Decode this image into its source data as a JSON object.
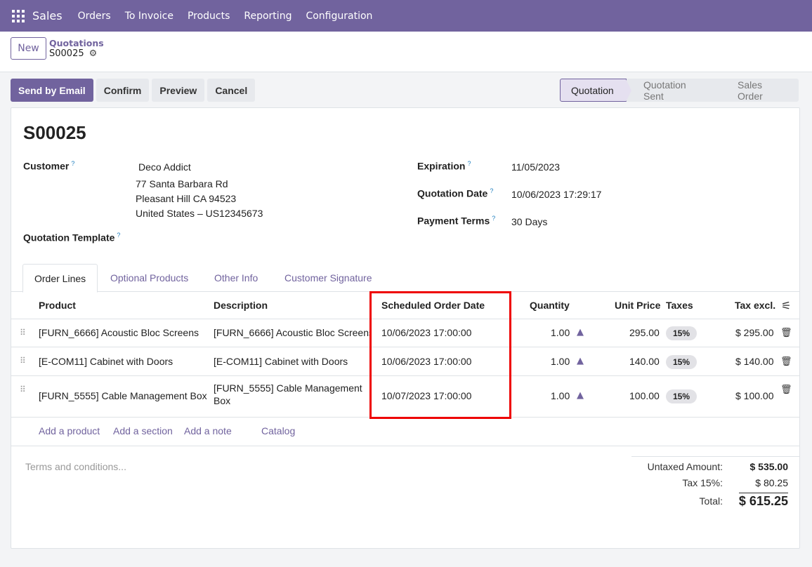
{
  "navbar": {
    "brand": "Sales",
    "items": [
      "Orders",
      "To Invoice",
      "Products",
      "Reporting",
      "Configuration"
    ],
    "color": "#71639e"
  },
  "control": {
    "new_label": "New",
    "breadcrumb_parent": "Quotations",
    "breadcrumb_current": "S00025"
  },
  "actions": {
    "send_by_email": "Send by Email",
    "confirm": "Confirm",
    "preview": "Preview",
    "cancel": "Cancel"
  },
  "statusbar": {
    "stages": [
      "Quotation",
      "Quotation Sent",
      "Sales Order"
    ],
    "active": "Quotation"
  },
  "record": {
    "title": "S00025",
    "customer_label": "Customer",
    "customer_name": "Deco Addict",
    "address_line1": "77 Santa Barbara Rd",
    "address_line2": "Pleasant Hill CA 94523",
    "address_line3": "United States – US12345673",
    "template_label": "Quotation Template",
    "expiration_label": "Expiration",
    "expiration_value": "11/05/2023",
    "quotation_date_label": "Quotation Date",
    "quotation_date_value": "10/06/2023 17:29:17",
    "payment_terms_label": "Payment Terms",
    "payment_terms_value": "30 Days",
    "help_mark": "?"
  },
  "tabs": [
    "Order Lines",
    "Optional Products",
    "Other Info",
    "Customer Signature"
  ],
  "table": {
    "headers": [
      "Product",
      "Description",
      "Scheduled Order Date",
      "Quantity",
      "Unit Price",
      "Taxes",
      "Tax excl."
    ],
    "rows": [
      {
        "product": "[FURN_6666] Acoustic Bloc Screens",
        "description": "[FURN_6666] Acoustic Bloc Screens",
        "date": "10/06/2023 17:00:00",
        "qty": "1.00",
        "price": "295.00",
        "tax": "15%",
        "subtotal": "$ 295.00"
      },
      {
        "product": "[E-COM11] Cabinet with Doors",
        "description": "[E-COM11] Cabinet with Doors",
        "date": "10/06/2023 17:00:00",
        "qty": "1.00",
        "price": "140.00",
        "tax": "15%",
        "subtotal": "$ 140.00"
      },
      {
        "product": "[FURN_5555] Cable Management Box",
        "description_line1": "[FURN_5555] Cable Management",
        "description_line2": "Box",
        "date": "10/07/2023 17:00:00",
        "qty": "1.00",
        "price": "100.00",
        "tax": "15%",
        "subtotal": "$ 100.00"
      }
    ],
    "add_links": [
      "Add a product",
      "Add a section",
      "Add a note",
      "Catalog"
    ]
  },
  "footer": {
    "terms_placeholder": "Terms and conditions...",
    "untaxed_label": "Untaxed Amount:",
    "untaxed_value": "$ 535.00",
    "tax_label": "Tax 15%:",
    "tax_value": "$ 80.25",
    "total_label": "Total:",
    "total_value": "$ 615.25"
  }
}
